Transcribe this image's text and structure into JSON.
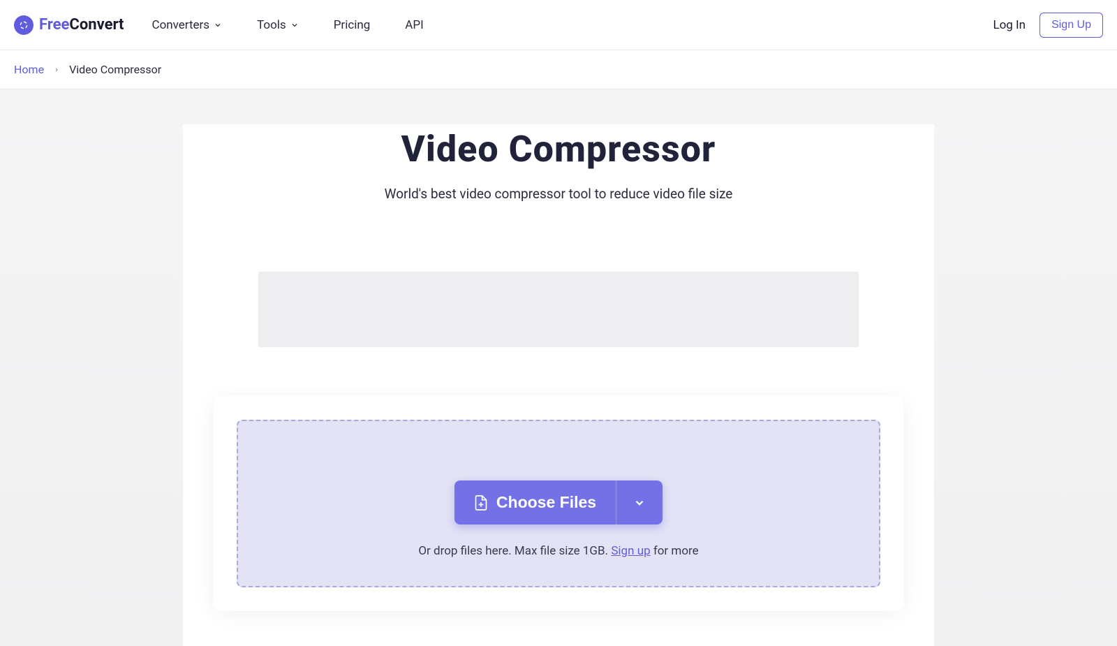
{
  "header": {
    "logo": {
      "part1": "Free",
      "part2": "Convert"
    },
    "nav": {
      "converters": "Converters",
      "tools": "Tools",
      "pricing": "Pricing",
      "api": "API"
    },
    "auth": {
      "login": "Log In",
      "signup": "Sign Up"
    }
  },
  "breadcrumb": {
    "home": "Home",
    "current": "Video Compressor"
  },
  "page": {
    "title": "Video Compressor",
    "subtitle": "World's best video compressor tool to reduce video file size"
  },
  "upload": {
    "choose_label": "Choose Files",
    "hint_prefix": "Or drop files here. Max file size 1GB. ",
    "hint_link": "Sign up",
    "hint_suffix": " for more"
  }
}
